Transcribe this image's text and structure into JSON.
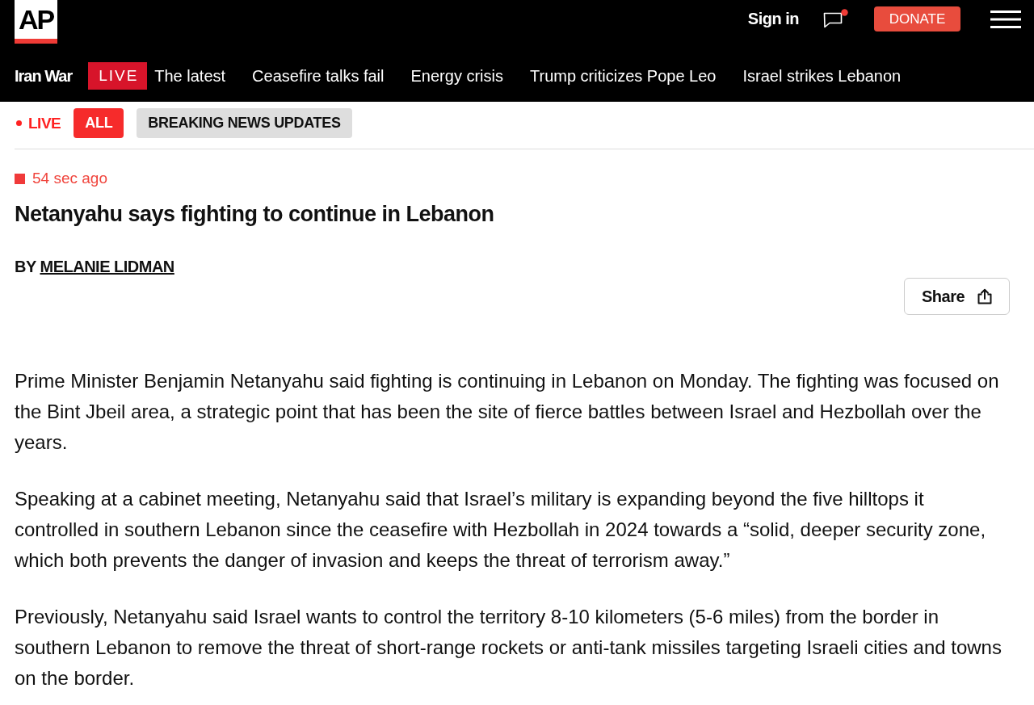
{
  "header": {
    "logo": "AP",
    "sign_in": "Sign in",
    "notifications": {
      "unread": true
    },
    "donate": "DONATE"
  },
  "nav": {
    "section": "Iran War",
    "badge": "LIVE",
    "links": [
      "The latest",
      "Ceasefire talks fail",
      "Energy crisis",
      "Trump criticizes Pope Leo",
      "Israel strikes Lebanon"
    ]
  },
  "filters": {
    "live_label": "LIVE",
    "tabs": [
      {
        "label": "ALL",
        "selected": true
      },
      {
        "label": "BREAKING NEWS UPDATES",
        "selected": false
      }
    ]
  },
  "post": {
    "timestamp": "54 sec ago",
    "headline": "Netanyahu says fighting to continue in Lebanon",
    "byline": {
      "prefix": "BY",
      "author": "MELANIE LIDMAN"
    },
    "share": "Share",
    "paragraphs": [
      "Prime Minister Benjamin Netanyahu said fighting is continuing in Lebanon on Monday. The fighting was focused on the Bint Jbeil area, a strategic point that has been the site of fierce battles between Israel and Hezbollah over the years.",
      "Speaking at a cabinet meeting, Netanyahu said that Israel’s military is expanding beyond the five hilltops it controlled in southern Lebanon since the ceasefire with Hezbollah in 2024 towards a “solid, deeper security zone, which both prevents the danger of invasion and keeps the threat of terrorism away.”",
      "Previously, Netanyahu said Israel wants to control the territory 8-10 kilometers (5-6 miles) from the border in southern Lebanon to remove the threat of short-range rockets or anti-tank missiles targeting Israeli cities and towns on the border."
    ]
  }
}
